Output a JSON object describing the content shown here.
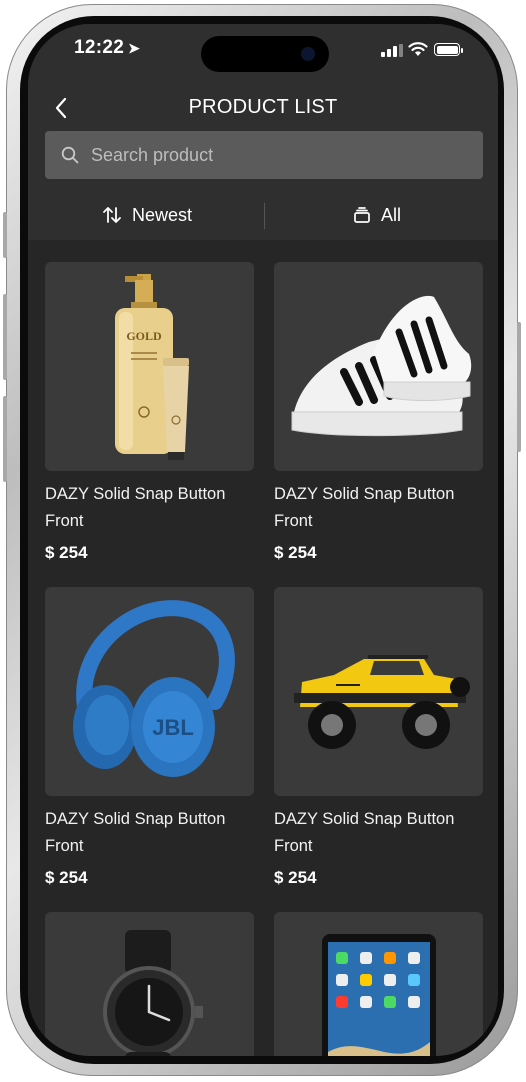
{
  "status": {
    "time": "12:22"
  },
  "header": {
    "title": "PRODUCT LIST"
  },
  "search": {
    "placeholder": "Search product"
  },
  "filters": {
    "sort_label": "Newest",
    "category_label": "All"
  },
  "products": [
    {
      "name": "DAZY Solid Snap Button Front",
      "price": "$ 254",
      "image": "lotion-bottle"
    },
    {
      "name": "DAZY Solid Snap Button Front",
      "price": "$ 254",
      "image": "sneakers"
    },
    {
      "name": "DAZY Solid Snap Button Front",
      "price": "$ 254",
      "image": "headphones"
    },
    {
      "name": "DAZY Solid Snap Button Front",
      "price": "$ 254",
      "image": "toy-jeep"
    },
    {
      "name": "",
      "price": "",
      "image": "wristwatch"
    },
    {
      "name": "",
      "price": "",
      "image": "tablet"
    }
  ],
  "colors": {
    "background": "#262626",
    "header": "#2f2f2f",
    "card": "#3a3a3a",
    "search": "#5b5b5b"
  }
}
